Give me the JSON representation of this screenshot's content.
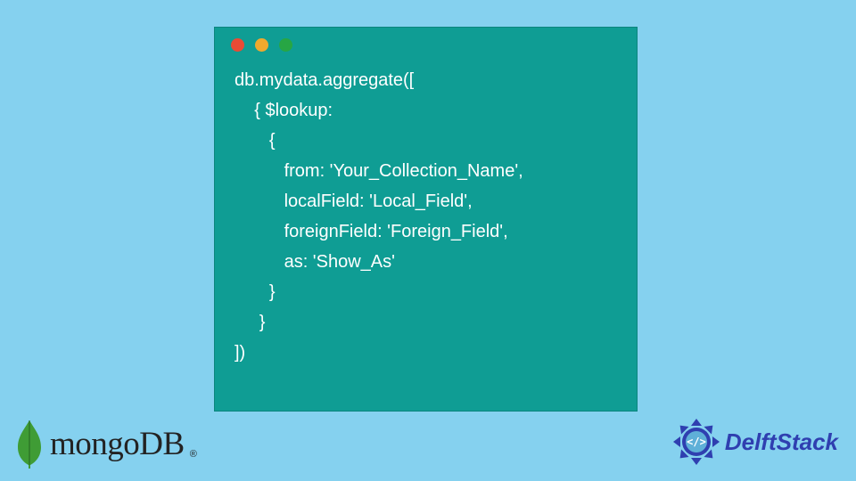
{
  "code": {
    "lines": [
      "db.mydata.aggregate([",
      "    { $lookup:",
      "       {",
      "          from: 'Your_Collection_Name',",
      "          localField: 'Local_Field',",
      "          foreignField: 'Foreign_Field',",
      "          as: 'Show_As'",
      "       }",
      "     }",
      "])"
    ]
  },
  "branding": {
    "mongodb": "mongoDB",
    "mongodb_reg": "®",
    "delftstack": "DelftStack"
  },
  "colors": {
    "background": "#85d1ef",
    "window": "#0f9d94",
    "code_text": "#ffffff",
    "dot_red": "#e94b35",
    "dot_yellow": "#f0a92e",
    "dot_green": "#27a644",
    "delftstack_blue": "#2f3fb0",
    "mongodb_leaf": "#3f9c35"
  }
}
